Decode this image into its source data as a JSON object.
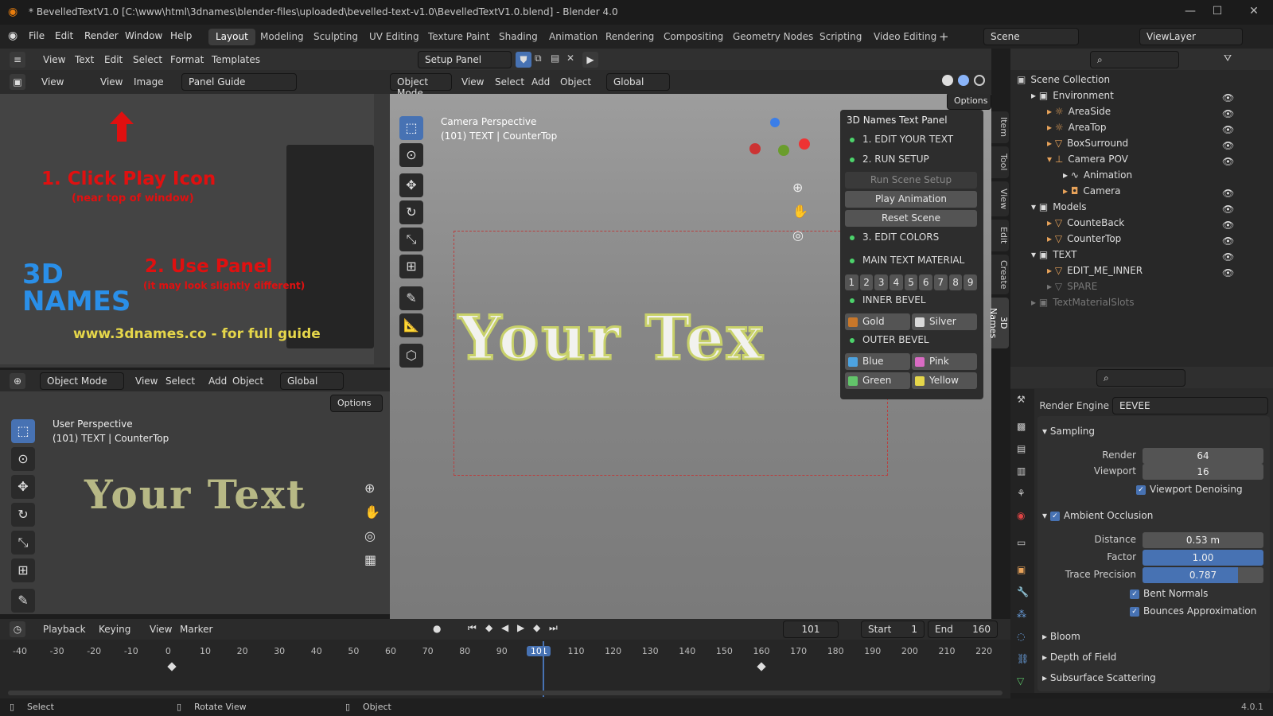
{
  "window": {
    "title": "* BevelledTextV1.0 [C:\\www\\html\\3dnames\\blender-files\\uploaded\\bevelled-text-v1.0\\BevelledTextV1.0.blend] - Blender 4.0",
    "version": "4.0.1"
  },
  "menu": [
    "File",
    "Edit",
    "Render",
    "Window",
    "Help"
  ],
  "workspaces": [
    "Layout",
    "Modeling",
    "Sculpting",
    "UV Editing",
    "Texture Paint",
    "Shading",
    "Animation",
    "Rendering",
    "Compositing",
    "Geometry Nodes",
    "Scripting",
    "Video Editing"
  ],
  "scene": "Scene",
  "viewlayer": "ViewLayer",
  "text_editor": {
    "menus": [
      "View",
      "Text",
      "Edit",
      "Select",
      "Format",
      "Templates"
    ],
    "file": "Setup Panel"
  },
  "image_editor": {
    "menus": [
      "View",
      "View",
      "Image"
    ],
    "image": "Panel Guide"
  },
  "guide": {
    "step1": "1. Click Play Icon",
    "step1_sub": "(near top of window)",
    "step2": "2. Use Panel",
    "step2_sub": "(it may look slightly different)",
    "url": "www.3dnames.co - for full guide",
    "logo": "3D NAMES"
  },
  "viewport_main": {
    "mode": "Object Mode",
    "menus": [
      "View",
      "Select",
      "Add",
      "Object"
    ],
    "orientation": "Global",
    "options": "Options",
    "persp": "Camera Perspective",
    "info": "(101) TEXT | CounterTop",
    "text3d": "Your Tex"
  },
  "viewport_small": {
    "mode": "Object Mode",
    "menus": [
      "View",
      "Select",
      "Add",
      "Object"
    ],
    "orientation": "Global",
    "options": "Options",
    "persp": "User Perspective",
    "info": "(101) TEXT | CounterTop",
    "text3d": "Your Text"
  },
  "names_panel": {
    "title": "3D Names Text Panel",
    "step1": "1. EDIT YOUR TEXT",
    "step2": "2. RUN SETUP",
    "run": "Run Scene Setup",
    "play": "Play Animation",
    "reset": "Reset Scene",
    "step3": "3. EDIT COLORS",
    "main_mat": "MAIN TEXT MATERIAL",
    "slots": [
      "1",
      "2",
      "3",
      "4",
      "5",
      "6",
      "7",
      "8",
      "9"
    ],
    "inner": "INNER BEVEL",
    "inner_opts": [
      {
        "label": "Gold",
        "color": "#c8772a"
      },
      {
        "label": "Silver",
        "color": "#d8d8d8"
      }
    ],
    "outer": "OUTER BEVEL",
    "outer_opts": [
      {
        "label": "Blue",
        "color": "#4da3e0"
      },
      {
        "label": "Pink",
        "color": "#d96bc3"
      },
      {
        "label": "Green",
        "color": "#62c46a"
      },
      {
        "label": "Yellow",
        "color": "#e5d64a"
      }
    ]
  },
  "side_tabs": [
    "Item",
    "Tool",
    "View",
    "Edit",
    "Create",
    "3D Names"
  ],
  "outliner": {
    "root": "Scene Collection",
    "items": [
      {
        "label": "Environment",
        "indent": 0
      },
      {
        "label": "AreaSide",
        "indent": 1
      },
      {
        "label": "AreaTop",
        "indent": 1
      },
      {
        "label": "BoxSurround",
        "indent": 1
      },
      {
        "label": "Camera POV",
        "indent": 1
      },
      {
        "label": "Animation",
        "indent": 2
      },
      {
        "label": "Camera",
        "indent": 2
      },
      {
        "label": "Models",
        "indent": 0
      },
      {
        "label": "CounteBack",
        "indent": 1
      },
      {
        "label": "CounterTop",
        "indent": 1
      },
      {
        "label": "TEXT",
        "indent": 0
      },
      {
        "label": "EDIT_ME_INNER",
        "indent": 1
      },
      {
        "label": "SPARE",
        "indent": 1
      },
      {
        "label": "TextMaterialSlots",
        "indent": 0
      }
    ]
  },
  "properties": {
    "engine_label": "Render Engine",
    "engine": "EEVEE",
    "sampling": "Sampling",
    "render_label": "Render",
    "render": "64",
    "viewport_label": "Viewport",
    "viewport": "16",
    "denoise": "Viewport Denoising",
    "ao": "Ambient Occlusion",
    "distance_label": "Distance",
    "distance": "0.53 m",
    "factor_label": "Factor",
    "factor": "1.00",
    "trace_label": "Trace Precision",
    "trace": "0.787",
    "trace_fill": 0.787,
    "bent": "Bent Normals",
    "bounces": "Bounces Approximation",
    "bloom": "Bloom",
    "dof": "Depth of Field",
    "sss": "Subsurface Scattering"
  },
  "timeline": {
    "menus": [
      "Playback",
      "Keying",
      "View",
      "Marker"
    ],
    "current": "101",
    "start_label": "Start",
    "start": "1",
    "end_label": "End",
    "end": "160",
    "ticks": [
      "-40",
      "-30",
      "-20",
      "-10",
      "0",
      "10",
      "20",
      "30",
      "40",
      "50",
      "60",
      "70",
      "80",
      "90",
      "101",
      "110",
      "120",
      "130",
      "140",
      "150",
      "160",
      "170",
      "180",
      "190",
      "200",
      "210",
      "220"
    ]
  },
  "status": {
    "select": "Select",
    "rotate": "Rotate View",
    "object": "Object"
  }
}
